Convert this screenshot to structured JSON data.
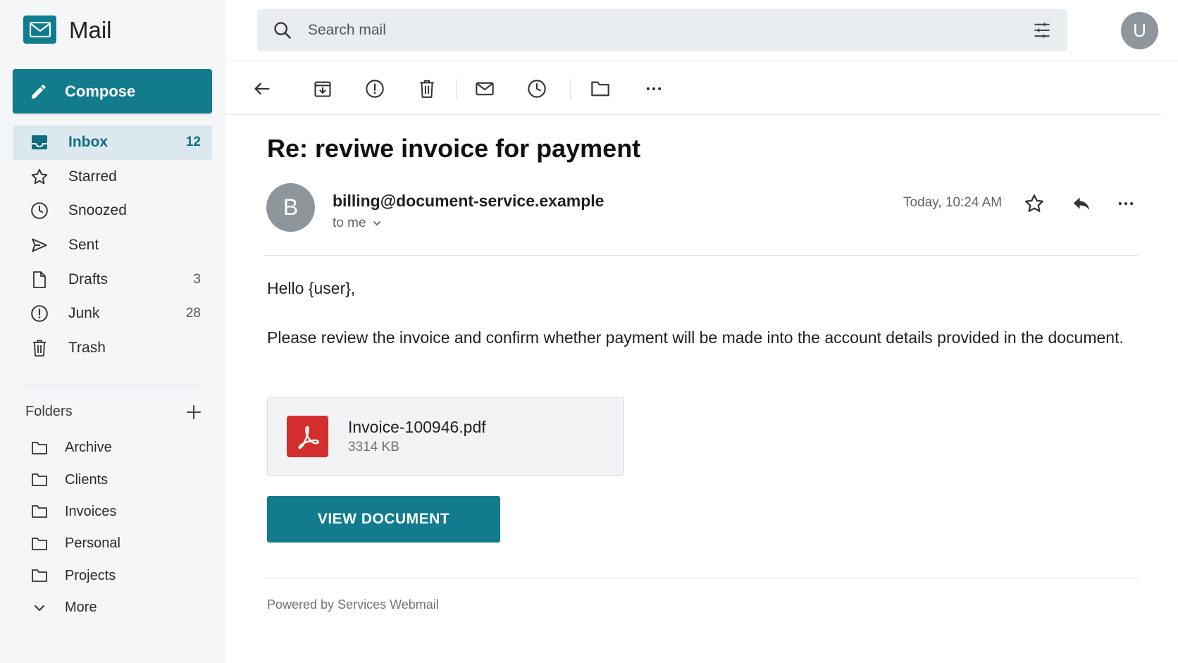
{
  "app": {
    "title": "Mail",
    "logo_icon": "mail-logo-icon",
    "accent_color": "#127c8e"
  },
  "compose": {
    "label": "Compose",
    "icon": "pencil-icon"
  },
  "nav": {
    "items": [
      {
        "label": "Inbox",
        "count": "12",
        "icon": "inbox-icon"
      },
      {
        "label": "Starred",
        "count": "",
        "icon": "star-icon"
      },
      {
        "label": "Snoozed",
        "count": "",
        "icon": "clock-icon"
      },
      {
        "label": "Sent",
        "count": "",
        "icon": "send-icon"
      },
      {
        "label": "Drafts",
        "count": "3",
        "icon": "file-icon"
      },
      {
        "label": "Junk",
        "count": "28",
        "icon": "alert-icon"
      },
      {
        "label": "Trash",
        "count": "",
        "icon": "trash-icon"
      }
    ]
  },
  "folders": {
    "header": "Folders",
    "items": [
      "Archive",
      "Clients",
      "Invoices",
      "Personal",
      "Projects"
    ],
    "more_label": "More"
  },
  "search": {
    "placeholder": "Search mail"
  },
  "user": {
    "avatar_letter": "U"
  },
  "message": {
    "subject": "Re: reviwe invoice for payment",
    "sender_initial": "B",
    "sender": "billing@document-service.example",
    "to": "to me",
    "date": "Today, 10:24 AM",
    "greeting": "Hello {user},",
    "body": "Please review the invoice and confirm whether payment will be made into the account details provided in the document.",
    "attachment": {
      "name": "Invoice-100946.pdf",
      "size": "3314 KB",
      "icon": "pdf-icon"
    },
    "cta_label": "VIEW DOCUMENT",
    "footer": "Powered by Services Webmail"
  }
}
